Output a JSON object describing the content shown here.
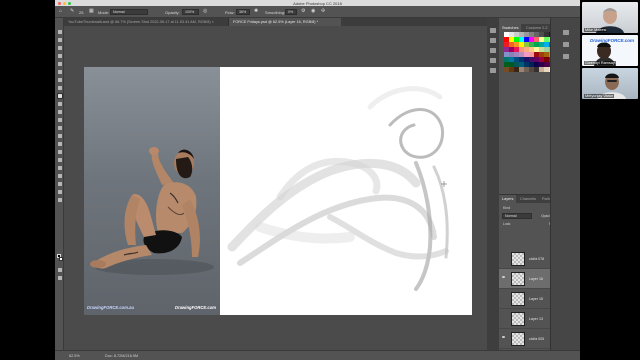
{
  "app": {
    "title": "Adobe Photoshop CC 2018"
  },
  "options_bar": {
    "brush_size": "25",
    "mode_label": "Mode:",
    "mode_value": "Normal",
    "opacity_label": "Opacity:",
    "opacity_value": "100%",
    "flow_label": "Flow:",
    "flow_value": "36%",
    "smoothing_label": "Smoothing:",
    "smoothing_value": "0%"
  },
  "document_tabs": [
    {
      "label": "YouTubeThumbnailLand @ 66.7% (Screen Shot 2022-06-17 at 11.53.41 AM, RGB/8) ×",
      "active": false
    },
    {
      "label": "FORCE Fridays.psd @ 62.5% (Layer 16, RGB/8) *",
      "active": true
    }
  ],
  "canvas": {
    "photo_watermark_left": "DrawingFORCE.com.au",
    "photo_watermark_right": "DrawingFORCE.com"
  },
  "status_bar": {
    "zoom": "62.5%",
    "doc_info": "Doc: 8.72M/216.9M"
  },
  "swatches_panel": {
    "tabs": [
      "Swatches",
      "Costume 2.2"
    ],
    "colors": [
      "#ffffff",
      "#e6e6e6",
      "#cccccc",
      "#b3b3b3",
      "#999999",
      "#808080",
      "#666666",
      "#4d4d4d",
      "#333333",
      "#1a1a1a",
      "#000000",
      "#ffffff",
      "#f0f0f0",
      "#ff0000",
      "#ffff00",
      "#00ff00",
      "#00ffff",
      "#0000ff",
      "#ff00ff",
      "#ff6666",
      "#ffff99",
      "#66ff66",
      "#66ffff",
      "#6666ff",
      "#ff66ff",
      "#c0c0c0",
      "#ed1c24",
      "#f26522",
      "#f7941d",
      "#fff200",
      "#8dc63f",
      "#39b54a",
      "#00a651",
      "#00a99d",
      "#00aeef",
      "#0072bc",
      "#0054a6",
      "#2e3192",
      "#662d91",
      "#92278f",
      "#9e005d",
      "#ed145b",
      "#f69679",
      "#f9ad81",
      "#fdc68a",
      "#fff799",
      "#c4df9b",
      "#a3d39c",
      "#82ca9c",
      "#7accc8",
      "#6dcff6",
      "#7da7d9",
      "#8393ca",
      "#8781bd",
      "#a186be",
      "#bd8cbf",
      "#f49ac2",
      "#f5989d",
      "#9e0b0f",
      "#a0410d",
      "#a36209",
      "#aba000",
      "#598527",
      "#1a7b30",
      "#007236",
      "#00746b",
      "#0076a3",
      "#004b80",
      "#003471",
      "#1b1464",
      "#440e62",
      "#630460",
      "#9e0039",
      "#790000",
      "#7b2e00",
      "#7d4900",
      "#827b00",
      "#406618",
      "#005e20",
      "#005826",
      "#005952",
      "#005b7f",
      "#003663",
      "#002157",
      "#0d004c",
      "#32004b",
      "#4b0049",
      "#7a0026",
      "#c69c6d",
      "#a67c52",
      "#8c6239",
      "#754c24",
      "#603913",
      "#3c2415",
      "#998675",
      "#736357",
      "#534741",
      "#362f2d",
      "#c7b299",
      "#e6d6bf",
      "#ffeeaa",
      "#ddeeff",
      "#aabbcc",
      "#ccbbaa"
    ]
  },
  "layers_panel": {
    "tabs": [
      "Layers",
      "Channels",
      "Paths"
    ],
    "kind_label": "Kind",
    "blend_mode": "Normal",
    "opacity_label": "Opacity:",
    "opacity_value": "100%",
    "lock_label": "Lock:",
    "fill_label": "Fill:",
    "fill_value": "100%",
    "layers": [
      {
        "name": "cicifa 078",
        "visible": false,
        "selected": false
      },
      {
        "name": "Layer 16",
        "visible": true,
        "selected": true
      },
      {
        "name": "Layer 15",
        "visible": false,
        "selected": false
      },
      {
        "name": "Layer 13",
        "visible": false,
        "selected": false
      },
      {
        "name": "cicifa 005",
        "visible": true,
        "selected": false
      },
      {
        "name": "Layer 11",
        "visible": false,
        "selected": false
      }
    ]
  },
  "video_call": {
    "participants": [
      {
        "name": "Mike Mattesi"
      },
      {
        "name": "Gwendyl Ramsay"
      },
      {
        "name": "Mrityunjay Varun"
      }
    ],
    "cam2_logo_text": "DrawingFORCE.com"
  }
}
